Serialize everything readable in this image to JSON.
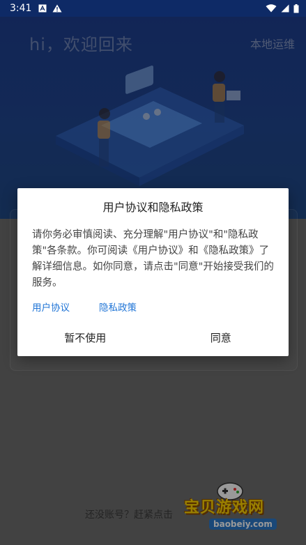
{
  "status_bar": {
    "time": "3:41",
    "left_icons": [
      "a-box-icon",
      "warning-icon"
    ],
    "right_icons": [
      "wifi-icon",
      "signal-icon",
      "battery-icon"
    ]
  },
  "header": {
    "greeting": "hi，欢迎回来",
    "local_ops": "本地运维"
  },
  "dialog": {
    "title": "用户协议和隐私政策",
    "body": "请你务必审慎阅读、充分理解\"用户协议\"和\"隐私政策\"各条款。你可阅读《用户协议》和《隐私政策》了解详细信息。如你同意，请点击\"同意\"开始接受我们的服务。",
    "links": {
      "user_agreement": "用户协议",
      "privacy_policy": "隐私政策"
    },
    "buttons": {
      "decline": "暂不使用",
      "agree": "同意"
    }
  },
  "footer": {
    "register_prompt": "还没账号？赶紧点击"
  },
  "watermark": {
    "title": "宝贝游戏网",
    "url": "baobeiy.com"
  },
  "colors": {
    "header_blue": "#20468f",
    "link_blue": "#1f74d6",
    "status_bar": "#0e2a66"
  }
}
